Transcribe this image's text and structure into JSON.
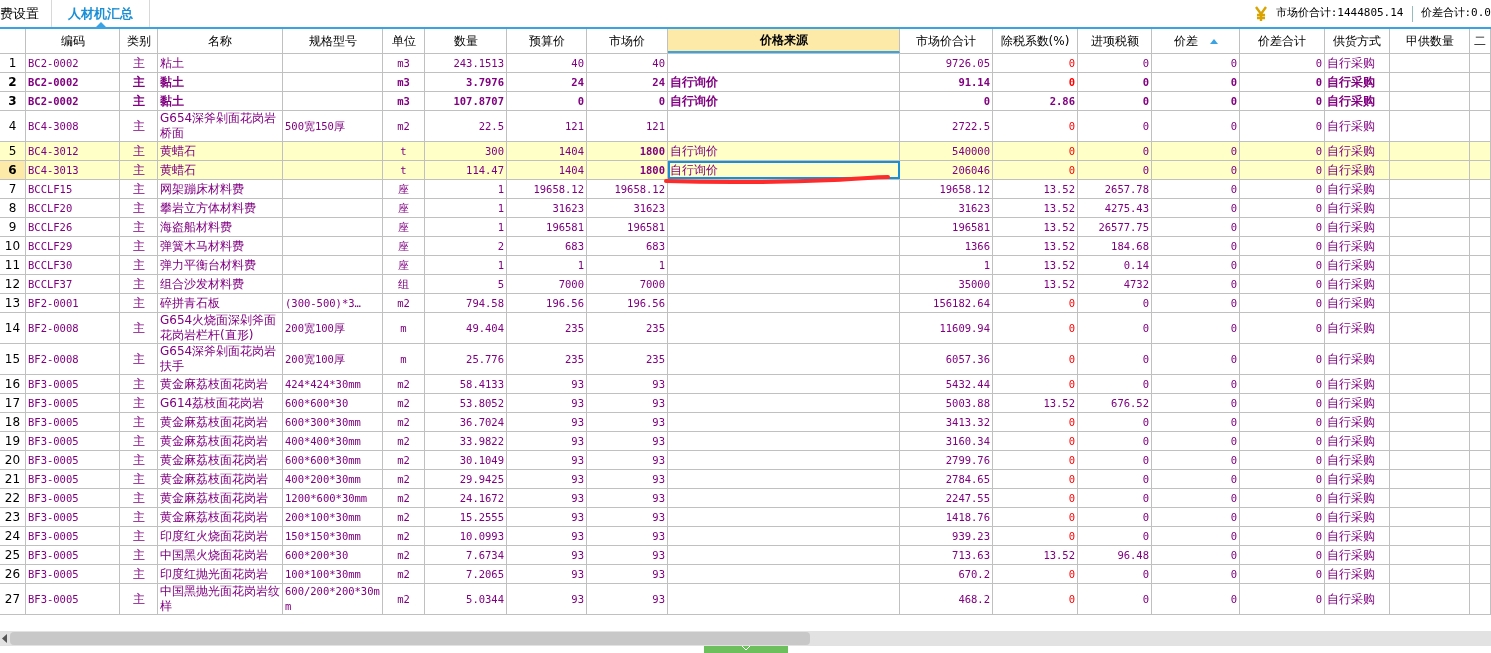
{
  "tabs": [
    {
      "label": "费设置",
      "selected": false
    },
    {
      "label": "人材机汇总",
      "selected": true
    }
  ],
  "summary": {
    "market_total": "市场价合计:1444805.14",
    "diff_total": "价差合计:0.0"
  },
  "table": {
    "columns": [
      {
        "sorted": false,
        "active": false
      },
      {
        "label": "编码",
        "sorted": false,
        "active": false
      },
      {
        "label": "类别",
        "sorted": false,
        "active": false
      },
      {
        "label": "名称",
        "sorted": false,
        "active": false
      },
      {
        "label": "规格型号",
        "sorted": false,
        "active": false
      },
      {
        "label": "单位",
        "sorted": false,
        "active": false
      },
      {
        "label": "数量",
        "sorted": false,
        "active": false
      },
      {
        "label": "预算价",
        "sorted": false,
        "active": false
      },
      {
        "label": "市场价",
        "sorted": false,
        "active": false
      },
      {
        "label": "价格来源",
        "sorted": false,
        "active": true
      },
      {
        "label": "市场价合计",
        "sorted": false,
        "active": false
      },
      {
        "label": "除税系数(%)",
        "sorted": false,
        "active": false
      },
      {
        "label": "进项税额",
        "sorted": false,
        "active": false
      },
      {
        "label": "价差",
        "sorted": true,
        "active": false
      },
      {
        "label": "价差合计",
        "sorted": false,
        "active": false
      },
      {
        "label": "供货方式",
        "sorted": false,
        "active": false
      },
      {
        "label": "甲供数量",
        "sorted": false,
        "active": false
      },
      {
        "label": "二",
        "sorted": false,
        "active": false
      }
    ],
    "rows": [
      {
        "cells": [
          "1",
          "BC2-0002",
          "主",
          "粘土",
          "",
          "m3",
          "243.1513",
          "40",
          "40",
          "",
          "9726.05",
          "0",
          "0",
          "0",
          "0",
          "自行采购",
          "",
          ""
        ],
        "bold": false,
        "highlighted": false,
        "selected": false,
        "rate_warning": true
      },
      {
        "cells": [
          "2",
          "BC2-0002",
          "主",
          "黏土",
          "",
          "m3",
          "3.7976",
          "24",
          "24",
          "自行询价",
          "91.14",
          "0",
          "0",
          "0",
          "0",
          "自行采购",
          "",
          ""
        ],
        "bold": true,
        "highlighted": false,
        "selected": false,
        "rate_warning": true
      },
      {
        "cells": [
          "3",
          "BC2-0002",
          "主",
          "黏土",
          "",
          "m3",
          "107.8707",
          "0",
          "0",
          "自行询价",
          "0",
          "2.86",
          "0",
          "0",
          "0",
          "自行采购",
          "",
          ""
        ],
        "bold": true,
        "highlighted": false,
        "selected": false,
        "rate_warning": false
      },
      {
        "cells": [
          "4",
          "BC4-3008",
          "主",
          "G654深斧剁面花岗岩桥面",
          "500宽150厚",
          "m2",
          "22.5",
          "121",
          "121",
          "",
          "2722.5",
          "0",
          "0",
          "0",
          "0",
          "自行采购",
          "",
          ""
        ],
        "bold": false,
        "highlighted": false,
        "selected": false,
        "rate_warning": true
      },
      {
        "cells": [
          "5",
          "BC4-3012",
          "主",
          "黄蜡石",
          "",
          "t",
          "300",
          "1404",
          "1800",
          "自行询价",
          "540000",
          "0",
          "0",
          "0",
          "0",
          "自行采购",
          "",
          ""
        ],
        "bold": false,
        "highlighted": true,
        "selected": false,
        "rate_warning": true
      },
      {
        "cells": [
          "6",
          "BC4-3013",
          "主",
          "黄蜡石",
          "",
          "t",
          "114.47",
          "1404",
          "1800",
          "自行询价",
          "206046",
          "0",
          "0",
          "0",
          "0",
          "自行采购",
          "",
          ""
        ],
        "bold": false,
        "highlighted": true,
        "selected": true,
        "rate_warning": true
      },
      {
        "cells": [
          "7",
          "BCCLF15",
          "主",
          "网架蹦床材料费",
          "",
          "座",
          "1",
          "19658.12",
          "19658.12",
          "",
          "19658.12",
          "13.52",
          "2657.78",
          "0",
          "0",
          "自行采购",
          "",
          ""
        ],
        "bold": false,
        "highlighted": false,
        "selected": false,
        "rate_warning": false
      },
      {
        "cells": [
          "8",
          "BCCLF20",
          "主",
          "攀岩立方体材料费",
          "",
          "座",
          "1",
          "31623",
          "31623",
          "",
          "31623",
          "13.52",
          "4275.43",
          "0",
          "0",
          "自行采购",
          "",
          ""
        ],
        "bold": false,
        "highlighted": false,
        "selected": false,
        "rate_warning": false
      },
      {
        "cells": [
          "9",
          "BCCLF26",
          "主",
          "海盗船材料费",
          "",
          "座",
          "1",
          "196581",
          "196581",
          "",
          "196581",
          "13.52",
          "26577.75",
          "0",
          "0",
          "自行采购",
          "",
          ""
        ],
        "bold": false,
        "highlighted": false,
        "selected": false,
        "rate_warning": false
      },
      {
        "cells": [
          "10",
          "BCCLF29",
          "主",
          "弹簧木马材料费",
          "",
          "座",
          "2",
          "683",
          "683",
          "",
          "1366",
          "13.52",
          "184.68",
          "0",
          "0",
          "自行采购",
          "",
          ""
        ],
        "bold": false,
        "highlighted": false,
        "selected": false,
        "rate_warning": false
      },
      {
        "cells": [
          "11",
          "BCCLF30",
          "主",
          "弹力平衡台材料费",
          "",
          "座",
          "1",
          "1",
          "1",
          "",
          "1",
          "13.52",
          "0.14",
          "0",
          "0",
          "自行采购",
          "",
          ""
        ],
        "bold": false,
        "highlighted": false,
        "selected": false,
        "rate_warning": false
      },
      {
        "cells": [
          "12",
          "BCCLF37",
          "主",
          "组合沙发材料费",
          "",
          "组",
          "5",
          "7000",
          "7000",
          "",
          "35000",
          "13.52",
          "4732",
          "0",
          "0",
          "自行采购",
          "",
          ""
        ],
        "bold": false,
        "highlighted": false,
        "selected": false,
        "rate_warning": false
      },
      {
        "cells": [
          "13",
          "BF2-0001",
          "主",
          "碎拼青石板",
          "(300-500)*3…",
          "m2",
          "794.58",
          "196.56",
          "196.56",
          "",
          "156182.64",
          "0",
          "0",
          "0",
          "0",
          "自行采购",
          "",
          ""
        ],
        "bold": false,
        "highlighted": false,
        "selected": false,
        "rate_warning": true
      },
      {
        "cells": [
          "14",
          "BF2-0008",
          "主",
          "G654火烧面深剁斧面花岗岩栏杆(直形)",
          "200宽100厚",
          "m",
          "49.404",
          "235",
          "235",
          "",
          "11609.94",
          "0",
          "0",
          "0",
          "0",
          "自行采购",
          "",
          ""
        ],
        "bold": false,
        "highlighted": false,
        "selected": false,
        "rate_warning": true
      },
      {
        "cells": [
          "15",
          "BF2-0008",
          "主",
          "G654深斧剁面花岗岩扶手",
          "200宽100厚",
          "m",
          "25.776",
          "235",
          "235",
          "",
          "6057.36",
          "0",
          "0",
          "0",
          "0",
          "自行采购",
          "",
          ""
        ],
        "bold": false,
        "highlighted": false,
        "selected": false,
        "rate_warning": true
      },
      {
        "cells": [
          "16",
          "BF3-0005",
          "主",
          "黄金麻荔枝面花岗岩",
          "424*424*30mm",
          "m2",
          "58.4133",
          "93",
          "93",
          "",
          "5432.44",
          "0",
          "0",
          "0",
          "0",
          "自行采购",
          "",
          ""
        ],
        "bold": false,
        "highlighted": false,
        "selected": false,
        "rate_warning": true
      },
      {
        "cells": [
          "17",
          "BF3-0005",
          "主",
          "G614荔枝面花岗岩",
          "600*600*30",
          "m2",
          "53.8052",
          "93",
          "93",
          "",
          "5003.88",
          "13.52",
          "676.52",
          "0",
          "0",
          "自行采购",
          "",
          ""
        ],
        "bold": false,
        "highlighted": false,
        "selected": false,
        "rate_warning": false
      },
      {
        "cells": [
          "18",
          "BF3-0005",
          "主",
          "黄金麻荔枝面花岗岩",
          "600*300*30mm",
          "m2",
          "36.7024",
          "93",
          "93",
          "",
          "3413.32",
          "0",
          "0",
          "0",
          "0",
          "自行采购",
          "",
          ""
        ],
        "bold": false,
        "highlighted": false,
        "selected": false,
        "rate_warning": true
      },
      {
        "cells": [
          "19",
          "BF3-0005",
          "主",
          "黄金麻荔枝面花岗岩",
          "400*400*30mm",
          "m2",
          "33.9822",
          "93",
          "93",
          "",
          "3160.34",
          "0",
          "0",
          "0",
          "0",
          "自行采购",
          "",
          ""
        ],
        "bold": false,
        "highlighted": false,
        "selected": false,
        "rate_warning": true
      },
      {
        "cells": [
          "20",
          "BF3-0005",
          "主",
          "黄金麻荔枝面花岗岩",
          "600*600*30mm",
          "m2",
          "30.1049",
          "93",
          "93",
          "",
          "2799.76",
          "0",
          "0",
          "0",
          "0",
          "自行采购",
          "",
          ""
        ],
        "bold": false,
        "highlighted": false,
        "selected": false,
        "rate_warning": true
      },
      {
        "cells": [
          "21",
          "BF3-0005",
          "主",
          "黄金麻荔枝面花岗岩",
          "400*200*30mm",
          "m2",
          "29.9425",
          "93",
          "93",
          "",
          "2784.65",
          "0",
          "0",
          "0",
          "0",
          "自行采购",
          "",
          ""
        ],
        "bold": false,
        "highlighted": false,
        "selected": false,
        "rate_warning": true
      },
      {
        "cells": [
          "22",
          "BF3-0005",
          "主",
          "黄金麻荔枝面花岗岩",
          "1200*600*30mm",
          "m2",
          "24.1672",
          "93",
          "93",
          "",
          "2247.55",
          "0",
          "0",
          "0",
          "0",
          "自行采购",
          "",
          ""
        ],
        "bold": false,
        "highlighted": false,
        "selected": false,
        "rate_warning": true
      },
      {
        "cells": [
          "23",
          "BF3-0005",
          "主",
          "黄金麻荔枝面花岗岩",
          "200*100*30mm",
          "m2",
          "15.2555",
          "93",
          "93",
          "",
          "1418.76",
          "0",
          "0",
          "0",
          "0",
          "自行采购",
          "",
          ""
        ],
        "bold": false,
        "highlighted": false,
        "selected": false,
        "rate_warning": true
      },
      {
        "cells": [
          "24",
          "BF3-0005",
          "主",
          "印度红火烧面花岗岩",
          "150*150*30mm",
          "m2",
          "10.0993",
          "93",
          "93",
          "",
          "939.23",
          "0",
          "0",
          "0",
          "0",
          "自行采购",
          "",
          ""
        ],
        "bold": false,
        "highlighted": false,
        "selected": false,
        "rate_warning": true
      },
      {
        "cells": [
          "25",
          "BF3-0005",
          "主",
          "中国黑火烧面花岗岩",
          "600*200*30",
          "m2",
          "7.6734",
          "93",
          "93",
          "",
          "713.63",
          "13.52",
          "96.48",
          "0",
          "0",
          "自行采购",
          "",
          ""
        ],
        "bold": false,
        "highlighted": false,
        "selected": false,
        "rate_warning": false
      },
      {
        "cells": [
          "26",
          "BF3-0005",
          "主",
          "印度红抛光面花岗岩",
          "100*100*30mm",
          "m2",
          "7.2065",
          "93",
          "93",
          "",
          "670.2",
          "0",
          "0",
          "0",
          "0",
          "自行采购",
          "",
          ""
        ],
        "bold": false,
        "highlighted": false,
        "selected": false,
        "rate_warning": true
      },
      {
        "cells": [
          "27",
          "BF3-0005",
          "主",
          "中国黑抛光面花岗岩纹样",
          "600/200*200*30mm",
          "m2",
          "5.0344",
          "93",
          "93",
          "",
          "468.2",
          "0",
          "0",
          "0",
          "0",
          "自行采购",
          "",
          ""
        ],
        "bold": false,
        "highlighted": false,
        "selected": false,
        "rate_warning": true
      }
    ]
  }
}
